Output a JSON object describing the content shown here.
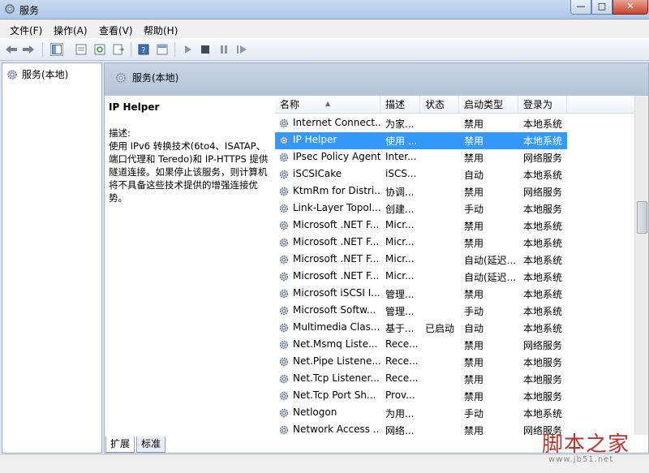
{
  "window": {
    "title": "服务",
    "min": "—",
    "max": "□",
    "close": "✕"
  },
  "menu": [
    "文件(F)",
    "操作(A)",
    "查看(V)",
    "帮助(H)"
  ],
  "tree": {
    "root": "服务(本地)"
  },
  "main_header": "服务(本地)",
  "detail": {
    "service": "IP Helper",
    "desc_label": "描述:",
    "desc_text": "使用 IPv6 转换技术(6to4、ISATAP、端口代理和 Teredo)和 IP-HTTPS 提供隧道连接。如果停止该服务，则计算机将不具备这些技术提供的增强连接优势。"
  },
  "table": {
    "headers": [
      "名称",
      "描述",
      "状态",
      "启动类型",
      "登录为"
    ],
    "rows": [
      {
        "name": "Internet Connect...",
        "desc": "为家...",
        "status": "",
        "start": "禁用",
        "logon": "本地系统"
      },
      {
        "name": "IP Helper",
        "desc": "使用 ...",
        "status": "",
        "start": "禁用",
        "logon": "本地系统"
      },
      {
        "name": "IPsec Policy Agent",
        "desc": "Inter...",
        "status": "",
        "start": "禁用",
        "logon": "网络服务"
      },
      {
        "name": "iSCSICake",
        "desc": "iSCS...",
        "status": "",
        "start": "自动",
        "logon": "本地系统"
      },
      {
        "name": "KtmRm for Distri...",
        "desc": "协调...",
        "status": "",
        "start": "禁用",
        "logon": "网络服务"
      },
      {
        "name": "Link-Layer Topol...",
        "desc": "创建...",
        "status": "",
        "start": "手动",
        "logon": "本地服务"
      },
      {
        "name": "Microsoft .NET F...",
        "desc": "Micr...",
        "status": "",
        "start": "禁用",
        "logon": "本地系统"
      },
      {
        "name": "Microsoft .NET F...",
        "desc": "Micr...",
        "status": "",
        "start": "禁用",
        "logon": "本地系统"
      },
      {
        "name": "Microsoft .NET F...",
        "desc": "Micr...",
        "status": "",
        "start": "自动(延迟...",
        "logon": "本地系统"
      },
      {
        "name": "Microsoft .NET F...",
        "desc": "Micr...",
        "status": "",
        "start": "自动(延迟...",
        "logon": "本地系统"
      },
      {
        "name": "Microsoft iSCSI I...",
        "desc": "管理...",
        "status": "",
        "start": "禁用",
        "logon": "本地系统"
      },
      {
        "name": "Microsoft Softw...",
        "desc": "管理...",
        "status": "",
        "start": "手动",
        "logon": "本地系统"
      },
      {
        "name": "Multimedia Clas...",
        "desc": "基于...",
        "status": "已启动",
        "start": "自动",
        "logon": "本地系统"
      },
      {
        "name": "Net.Msmq Liste...",
        "desc": "Rece...",
        "status": "",
        "start": "禁用",
        "logon": "网络服务"
      },
      {
        "name": "Net.Pipe Listene...",
        "desc": "Rece...",
        "status": "",
        "start": "禁用",
        "logon": "本地服务"
      },
      {
        "name": "Net.Tcp Listener...",
        "desc": "Rece...",
        "status": "",
        "start": "禁用",
        "logon": "本地服务"
      },
      {
        "name": "Net.Tcp Port Sh...",
        "desc": "Prov...",
        "status": "",
        "start": "禁用",
        "logon": "本地服务"
      },
      {
        "name": "Netlogon",
        "desc": "为用...",
        "status": "",
        "start": "手动",
        "logon": "本地系统"
      },
      {
        "name": "Network Access ...",
        "desc": "网络...",
        "status": "",
        "start": "禁用",
        "logon": "网络服务"
      }
    ],
    "selected_index": 1
  },
  "tabs": [
    "扩展",
    "标准"
  ],
  "watermark": {
    "main": "脚本之家",
    "sub": "www.jb51.net"
  },
  "colors": {
    "selection": "#3399ff",
    "header_bg": "#b4c4d9",
    "watermark": "#c0322b"
  }
}
